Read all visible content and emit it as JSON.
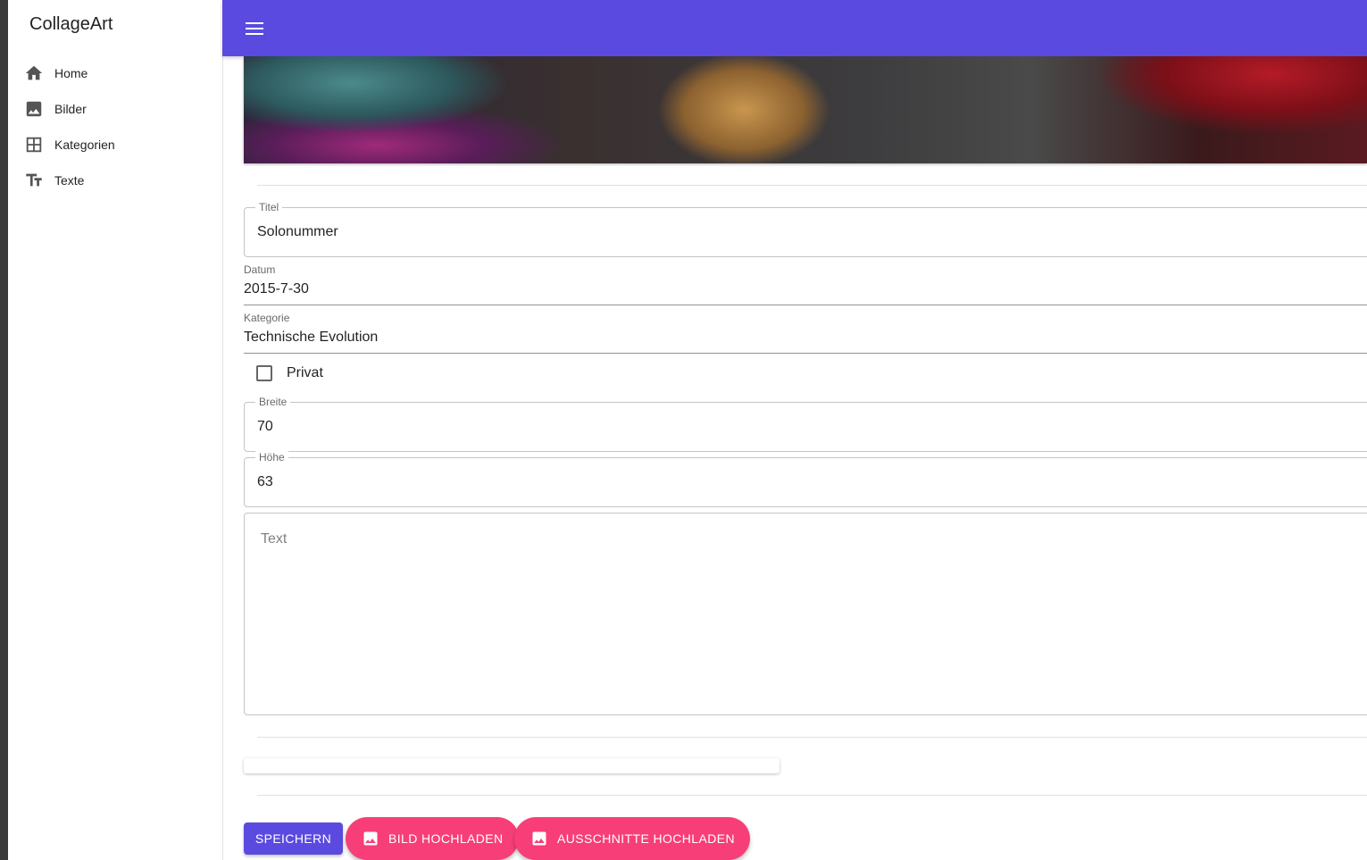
{
  "app": {
    "brand": "CollageArt"
  },
  "sidebar": {
    "items": [
      {
        "label": "Home",
        "icon": "home-icon"
      },
      {
        "label": "Bilder",
        "icon": "image-icon"
      },
      {
        "label": "Kategorien",
        "icon": "grid-icon"
      },
      {
        "label": "Texte",
        "icon": "text-fields-icon"
      }
    ]
  },
  "colors": {
    "primary": "#5b4ae0",
    "secondary": "#f73e78"
  },
  "form": {
    "titel": {
      "label": "Titel",
      "value": "Solonummer"
    },
    "datum": {
      "label": "Datum",
      "value": "2015-7-30"
    },
    "kategorie": {
      "label": "Kategorie",
      "value": "Technische Evolution"
    },
    "privat": {
      "label": "Privat",
      "checked": false
    },
    "breite": {
      "label": "Breite",
      "value": "70"
    },
    "hoehe": {
      "label": "Höhe",
      "value": "63"
    },
    "text": {
      "placeholder": "Text",
      "value": ""
    }
  },
  "actions": {
    "save": "SPEICHERN",
    "upload_image": "BILD HOCHLADEN",
    "upload_cutouts": "AUSSCHNITTE HOCHLADEN"
  }
}
